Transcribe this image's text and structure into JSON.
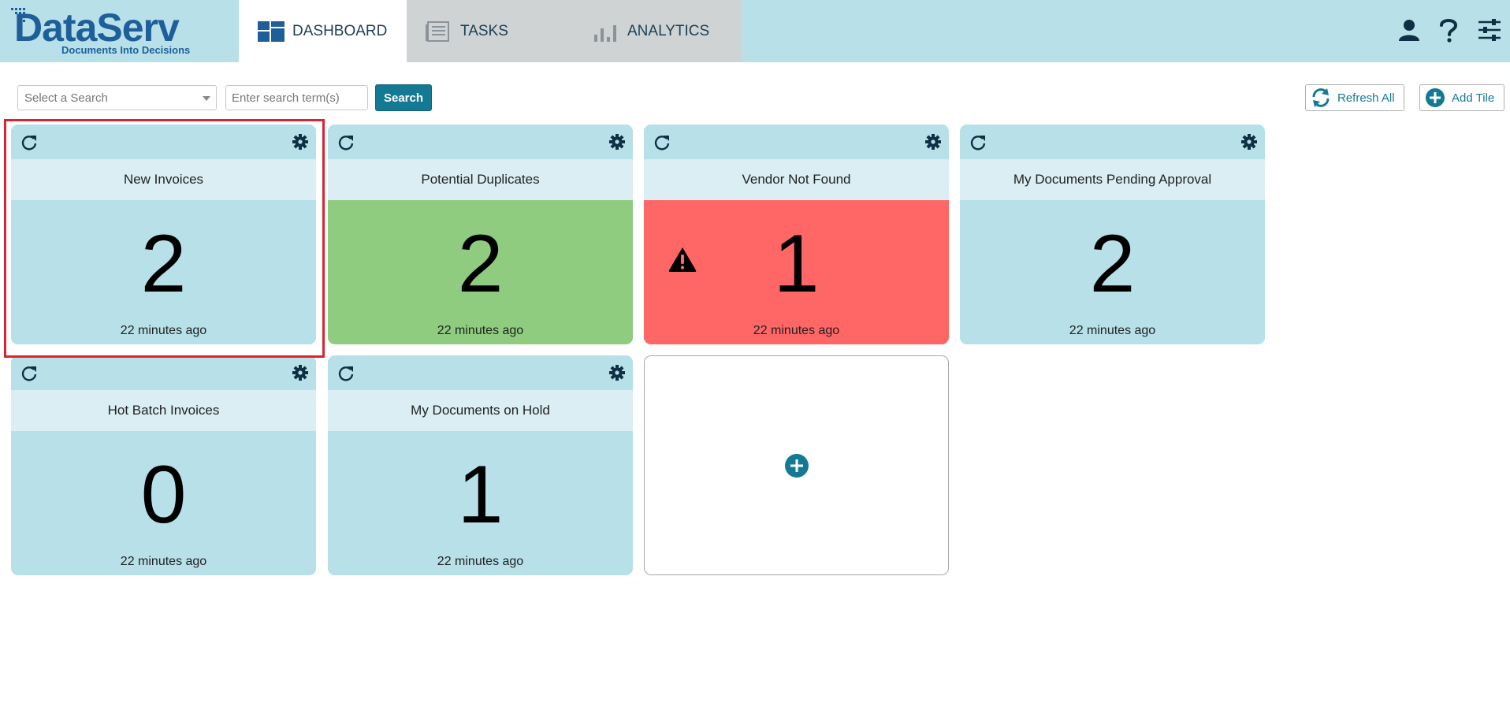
{
  "app": {
    "logo_text": "DataServ",
    "logo_tagline": "Documents Into Decisions",
    "brand_color": "#1f5f99",
    "accent_color": "#147a94"
  },
  "nav": {
    "tabs": [
      {
        "label": "DASHBOARD",
        "icon": "dashboard-icon",
        "active": true
      },
      {
        "label": "TASKS",
        "icon": "tasks-icon",
        "active": false
      },
      {
        "label": "ANALYTICS",
        "icon": "analytics-icon",
        "active": false
      }
    ],
    "right_icons": [
      "user-icon",
      "help-icon",
      "settings-sliders-icon"
    ]
  },
  "toolbar": {
    "select_placeholder": "Select a Search",
    "search_placeholder": "Enter search term(s)",
    "search_label": "Search",
    "refresh_all_label": "Refresh All",
    "add_tile_label": "Add Tile"
  },
  "tiles": [
    {
      "title": "New Invoices",
      "count": "2",
      "updated": "22 minutes ago",
      "status_color": "#b7e0e9",
      "selected": true
    },
    {
      "title": "Potential Duplicates",
      "count": "2",
      "updated": "22 minutes ago",
      "status_color": "#8fcc7f"
    },
    {
      "title": "Vendor Not Found",
      "count": "1",
      "updated": "22 minutes ago",
      "status_color": "#ff6666",
      "warning": true
    },
    {
      "title": "My Documents Pending Approval",
      "count": "2",
      "updated": "22 minutes ago",
      "status_color": "#b7e0e9"
    },
    {
      "title": "Hot Batch Invoices",
      "count": "0",
      "updated": "22 minutes ago",
      "status_color": "#b7e0e9"
    },
    {
      "title": "My Documents on Hold",
      "count": "1",
      "updated": "22 minutes ago",
      "status_color": "#b7e0e9"
    }
  ]
}
